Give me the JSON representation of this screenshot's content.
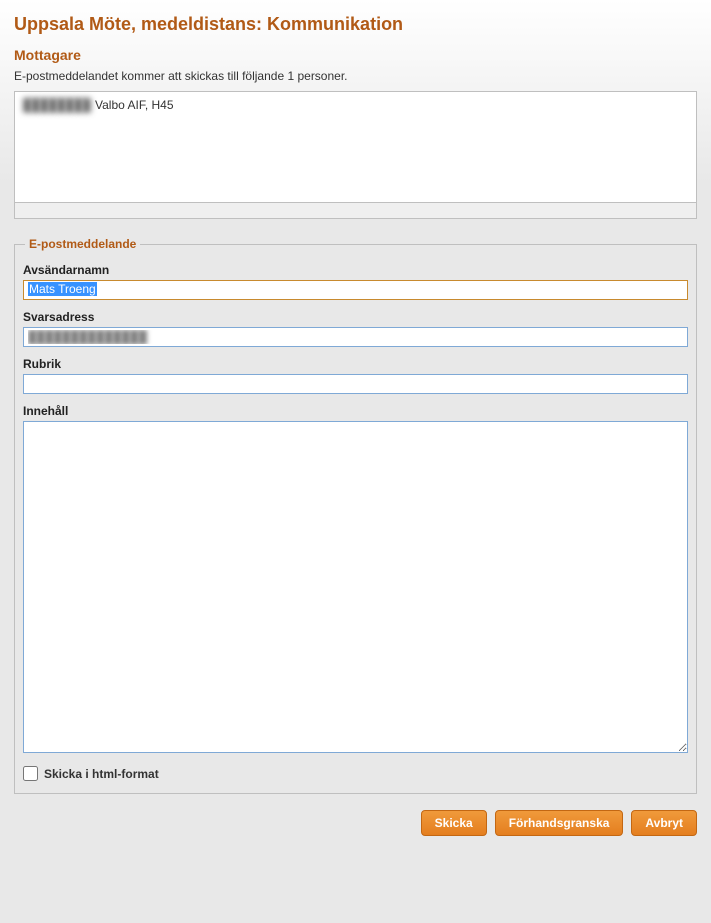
{
  "header": {
    "page_title": "Uppsala Möte, medeldistans: Kommunikation"
  },
  "recipients": {
    "section_title": "Mottagare",
    "subtext": "E-postmeddelandet kommer att skickas till följande 1 personer.",
    "items": [
      {
        "name_hidden": "████████",
        "club_class": "Valbo AIF, H45"
      }
    ]
  },
  "email": {
    "legend": "E-postmeddelande",
    "sender_name": {
      "label": "Avsändarnamn",
      "value": "Mats Troeng"
    },
    "reply_to": {
      "label": "Svarsadress",
      "value": "██████████████"
    },
    "subject": {
      "label": "Rubrik",
      "value": ""
    },
    "body": {
      "label": "Innehåll",
      "value": ""
    },
    "html_format": {
      "label": "Skicka i html-format",
      "checked": false
    }
  },
  "buttons": {
    "send": "Skicka",
    "preview": "Förhandsgranska",
    "cancel": "Avbryt"
  }
}
